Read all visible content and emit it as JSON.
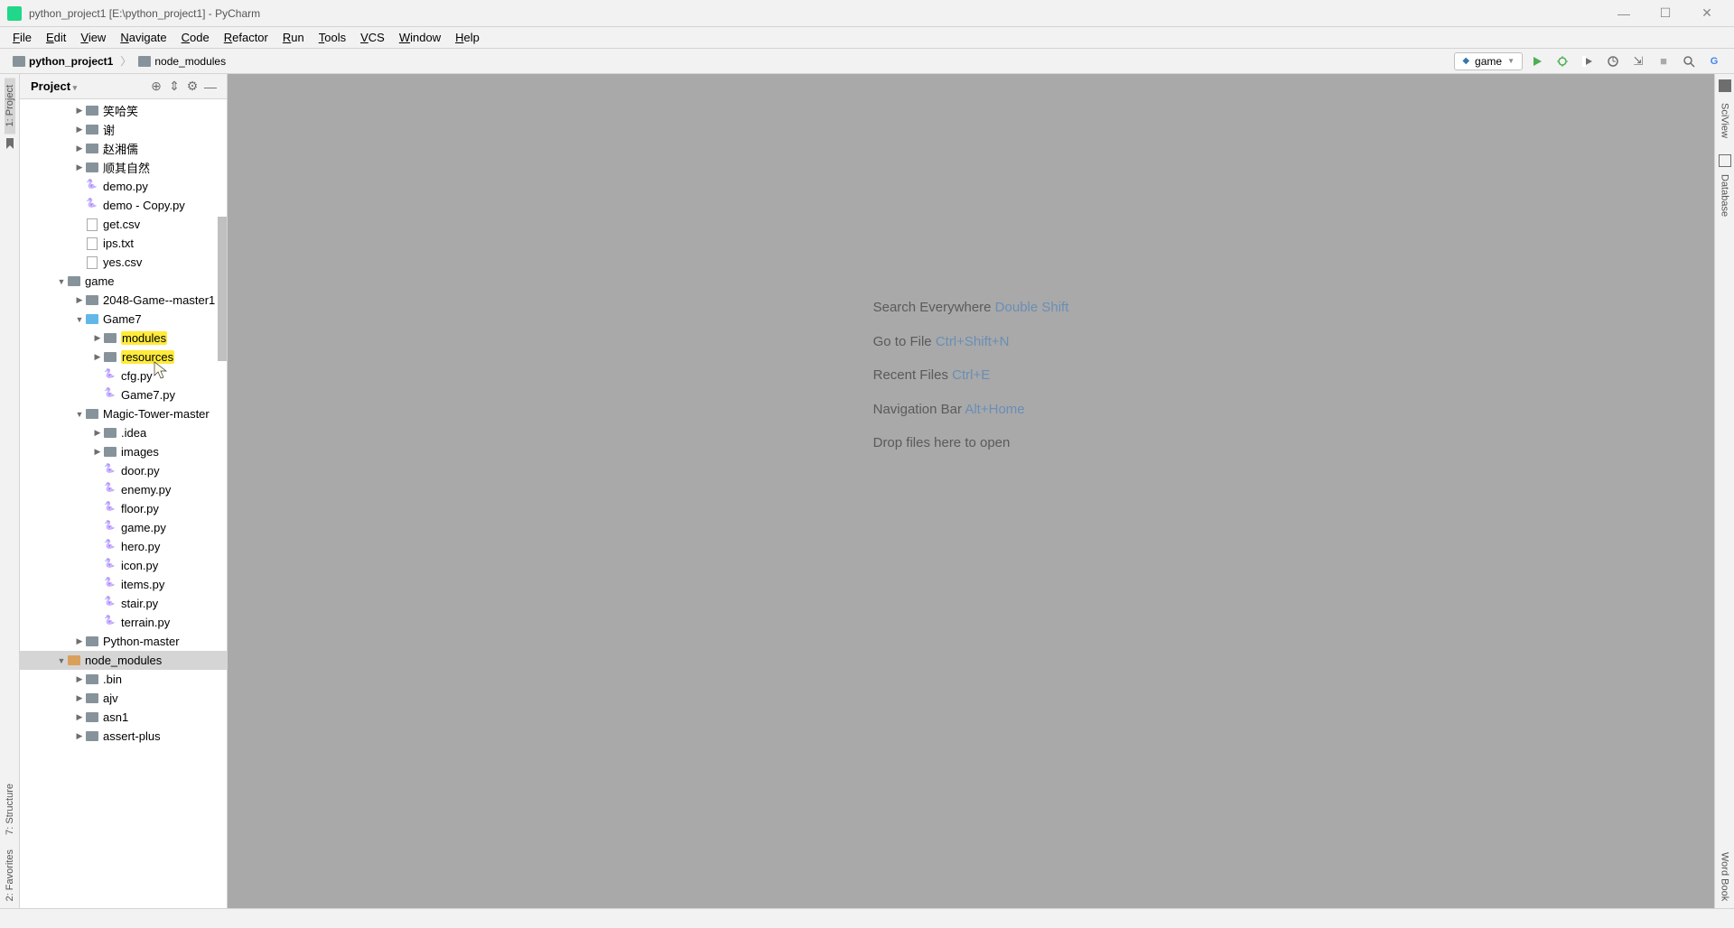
{
  "window_title": "python_project1 [E:\\python_project1] - PyCharm",
  "menus": [
    "File",
    "Edit",
    "View",
    "Navigate",
    "Code",
    "Refactor",
    "Run",
    "Tools",
    "VCS",
    "Window",
    "Help"
  ],
  "breadcrumb": [
    {
      "name": "python_project1",
      "bold": true
    },
    {
      "name": "node_modules"
    }
  ],
  "run_config": "game",
  "panel": {
    "title": "Project"
  },
  "leftrail": {
    "top": "1: Project",
    "mid": "7: Structure",
    "bottom": "2: Favorites"
  },
  "rightrail": {
    "a": "SciView",
    "b": "Database",
    "c": "Word Book"
  },
  "welcome": {
    "lines": [
      {
        "text": "Search Everywhere ",
        "shortcut": "Double Shift"
      },
      {
        "text": "Go to File ",
        "shortcut": "Ctrl+Shift+N"
      },
      {
        "text": "Recent Files ",
        "shortcut": "Ctrl+E"
      },
      {
        "text": "Navigation Bar ",
        "shortcut": "Alt+Home"
      },
      {
        "text": "Drop files here to open",
        "shortcut": ""
      }
    ]
  },
  "tree": [
    {
      "indent": 3,
      "arrow": ">",
      "icon": "folder",
      "label": "笑哈笑"
    },
    {
      "indent": 3,
      "arrow": ">",
      "icon": "folder",
      "label": "谢"
    },
    {
      "indent": 3,
      "arrow": ">",
      "icon": "folder",
      "label": "赵湘儒"
    },
    {
      "indent": 3,
      "arrow": ">",
      "icon": "folder",
      "label": "顺其自然"
    },
    {
      "indent": 3,
      "arrow": "",
      "icon": "py",
      "label": "demo.py"
    },
    {
      "indent": 3,
      "arrow": "",
      "icon": "py",
      "label": "demo - Copy.py"
    },
    {
      "indent": 3,
      "arrow": "",
      "icon": "file",
      "label": "get.csv"
    },
    {
      "indent": 3,
      "arrow": "",
      "icon": "file",
      "label": "ips.txt"
    },
    {
      "indent": 3,
      "arrow": "",
      "icon": "file",
      "label": "yes.csv"
    },
    {
      "indent": 2,
      "arrow": "v",
      "icon": "folder-open",
      "label": "game"
    },
    {
      "indent": 3,
      "arrow": ">",
      "icon": "folder",
      "label": "2048-Game--master1"
    },
    {
      "indent": 3,
      "arrow": "v",
      "icon": "folder-src",
      "label": "Game7"
    },
    {
      "indent": 4,
      "arrow": ">",
      "icon": "folder",
      "label": "modules",
      "hl": true
    },
    {
      "indent": 4,
      "arrow": ">",
      "icon": "folder",
      "label": "resources",
      "hl": true
    },
    {
      "indent": 4,
      "arrow": "",
      "icon": "py",
      "label": "cfg.py"
    },
    {
      "indent": 4,
      "arrow": "",
      "icon": "py",
      "label": "Game7.py"
    },
    {
      "indent": 3,
      "arrow": "v",
      "icon": "folder-open",
      "label": "Magic-Tower-master"
    },
    {
      "indent": 4,
      "arrow": ">",
      "icon": "folder",
      "label": ".idea"
    },
    {
      "indent": 4,
      "arrow": ">",
      "icon": "folder",
      "label": "images"
    },
    {
      "indent": 4,
      "arrow": "",
      "icon": "py",
      "label": "door.py"
    },
    {
      "indent": 4,
      "arrow": "",
      "icon": "py",
      "label": "enemy.py"
    },
    {
      "indent": 4,
      "arrow": "",
      "icon": "py",
      "label": "floor.py"
    },
    {
      "indent": 4,
      "arrow": "",
      "icon": "py",
      "label": "game.py"
    },
    {
      "indent": 4,
      "arrow": "",
      "icon": "py",
      "label": "hero.py"
    },
    {
      "indent": 4,
      "arrow": "",
      "icon": "py",
      "label": "icon.py"
    },
    {
      "indent": 4,
      "arrow": "",
      "icon": "py",
      "label": "items.py"
    },
    {
      "indent": 4,
      "arrow": "",
      "icon": "py",
      "label": "stair.py"
    },
    {
      "indent": 4,
      "arrow": "",
      "icon": "py",
      "label": "terrain.py"
    },
    {
      "indent": 3,
      "arrow": ">",
      "icon": "folder",
      "label": "Python-master"
    },
    {
      "indent": 2,
      "arrow": "v",
      "icon": "folder-lib",
      "label": "node_modules",
      "selected": true
    },
    {
      "indent": 3,
      "arrow": ">",
      "icon": "folder",
      "label": ".bin"
    },
    {
      "indent": 3,
      "arrow": ">",
      "icon": "folder",
      "label": "ajv"
    },
    {
      "indent": 3,
      "arrow": ">",
      "icon": "folder",
      "label": "asn1"
    },
    {
      "indent": 3,
      "arrow": ">",
      "icon": "folder",
      "label": "assert-plus"
    }
  ]
}
